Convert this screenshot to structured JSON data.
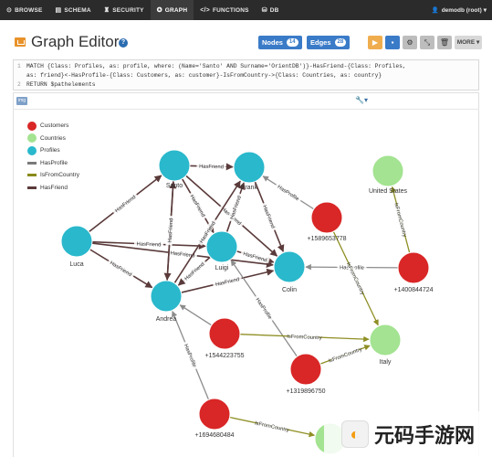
{
  "nav": {
    "items": [
      {
        "icon": "⊙",
        "label": "BROWSE",
        "active": false,
        "name": "browse"
      },
      {
        "icon": "▤",
        "label": "SCHEMA",
        "active": false,
        "name": "schema"
      },
      {
        "icon": "♜",
        "label": "SECURITY",
        "active": false,
        "name": "security"
      },
      {
        "icon": "✪",
        "label": "GRAPH",
        "active": true,
        "name": "graph"
      },
      {
        "icon": "</>",
        "label": "FUNCTIONS",
        "active": false,
        "name": "functions"
      },
      {
        "icon": "⛁",
        "label": "DB",
        "active": false,
        "name": "db"
      }
    ],
    "user": "demodb (root)"
  },
  "header": {
    "title": "Graph Editor",
    "help": "?",
    "nodes_label": "Nodes",
    "nodes_count": "14",
    "edges_label": "Edges",
    "edges_count": "28",
    "more_label": "MORE"
  },
  "query": {
    "lines": [
      [
        "1",
        "MATCH {Class: Profiles, as: profile, where: (Name='Santo' AND Surname='OrientDB')}-HasFriend-{Class: Profiles,"
      ],
      [
        "",
        "as: friend}<-HasProfile-{Class: Customers, as: customer}-IsFromCountry->{Class: Countries, as: country}"
      ],
      [
        "2",
        "RETURN $pathelements"
      ]
    ]
  },
  "legend": [
    {
      "type": "dot",
      "label": "Customers",
      "color": "#d92626"
    },
    {
      "type": "dot",
      "label": "Countries",
      "color": "#a3e391"
    },
    {
      "type": "dot",
      "label": "Profiles",
      "color": "#2ab8cc"
    },
    {
      "type": "line",
      "label": "HasProfile",
      "color": "#7a7a7a"
    },
    {
      "type": "line",
      "label": "IsFromCountry",
      "color": "#8a8a1a"
    },
    {
      "type": "line",
      "label": "HasFriend",
      "color": "#5a3a3a"
    }
  ],
  "colors": {
    "customer": "#d92626",
    "country": "#a3e391",
    "profile": "#2ab8cc",
    "hasFriend": "#5a3a3a",
    "hasProfile": "#8c8c8c",
    "isFromCountry": "#8f8f25"
  },
  "nodes": [
    {
      "id": "santo",
      "label": "Santo",
      "kind": "profile"
    },
    {
      "id": "frank",
      "label": "Frank",
      "kind": "profile"
    },
    {
      "id": "luca",
      "label": "Luca",
      "kind": "profile"
    },
    {
      "id": "luigi",
      "label": "Luigi",
      "kind": "profile"
    },
    {
      "id": "colin",
      "label": "Colin",
      "kind": "profile"
    },
    {
      "id": "andrea",
      "label": "Andrea",
      "kind": "profile"
    },
    {
      "id": "c1589",
      "label": "+1589653778",
      "kind": "customer"
    },
    {
      "id": "c1400",
      "label": "+1400844724",
      "kind": "customer"
    },
    {
      "id": "c1544",
      "label": "+1544223755",
      "kind": "customer"
    },
    {
      "id": "c1319",
      "label": "+1319896750",
      "kind": "customer"
    },
    {
      "id": "c1694",
      "label": "+1694680484",
      "kind": "customer"
    },
    {
      "id": "us",
      "label": "United States",
      "kind": "country"
    },
    {
      "id": "italy",
      "label": "Italy",
      "kind": "country"
    },
    {
      "id": "country3",
      "label": "",
      "kind": "country"
    }
  ],
  "edges": [
    {
      "from": "santo",
      "to": "frank",
      "label": "HasFriend",
      "kind": "hasFriend"
    },
    {
      "from": "luca",
      "to": "santo",
      "label": "HasFriend",
      "kind": "hasFriend"
    },
    {
      "from": "luca",
      "to": "luigi",
      "label": "HasFriend",
      "kind": "hasFriend"
    },
    {
      "from": "luca",
      "to": "colin",
      "label": "HasFriend",
      "kind": "hasFriend"
    },
    {
      "from": "luca",
      "to": "andrea",
      "label": "HasFriend",
      "kind": "hasFriend"
    },
    {
      "from": "andrea",
      "to": "santo",
      "label": "HasFriend",
      "kind": "hasFriend"
    },
    {
      "from": "santo",
      "to": "luigi",
      "label": "HasFriend",
      "kind": "hasFriend"
    },
    {
      "from": "santo",
      "to": "colin",
      "label": "HasFriend",
      "kind": "hasFriend"
    },
    {
      "from": "luigi",
      "to": "frank",
      "label": "HasFriend",
      "kind": "hasFriend"
    },
    {
      "from": "andrea",
      "to": "frank",
      "label": "HasFriend",
      "kind": "hasFriend"
    },
    {
      "from": "andrea",
      "to": "colin",
      "label": "HasFriend",
      "kind": "hasFriend"
    },
    {
      "from": "luigi",
      "to": "colin",
      "label": "HasFriend",
      "kind": "hasFriend"
    },
    {
      "from": "santo",
      "to": "andrea",
      "label": "HasFriend",
      "kind": "hasFriend"
    },
    {
      "from": "luigi",
      "to": "andrea",
      "label": "HasFriend",
      "kind": "hasFriend"
    },
    {
      "from": "frank",
      "to": "colin",
      "label": "HasFriend",
      "kind": "hasFriend"
    },
    {
      "from": "c1589",
      "to": "frank",
      "label": "HasProfile",
      "kind": "hasProfile"
    },
    {
      "from": "c1400",
      "to": "colin",
      "label": "HasProfile",
      "kind": "hasProfile"
    },
    {
      "from": "c1319",
      "to": "luigi",
      "label": "HasProfile",
      "kind": "hasProfile"
    },
    {
      "from": "c1694",
      "to": "andrea",
      "label": "HasProfile",
      "kind": "hasProfile"
    },
    {
      "from": "c1544",
      "to": "andrea",
      "label": "",
      "kind": "hasProfile"
    },
    {
      "from": "c1589",
      "to": "italy",
      "label": "IsFromCountry",
      "kind": "isFromCountry"
    },
    {
      "from": "c1400",
      "to": "us",
      "label": "IsFromCountry",
      "kind": "isFromCountry"
    },
    {
      "from": "c1544",
      "to": "italy",
      "label": "IsFromCountry",
      "kind": "isFromCountry"
    },
    {
      "from": "c1319",
      "to": "italy",
      "label": "IsFromCountry",
      "kind": "isFromCountry"
    },
    {
      "from": "c1694",
      "to": "country3",
      "label": "IsFromCountry",
      "kind": "isFromCountry"
    }
  ],
  "watermark": {
    "text": "元码手游网"
  }
}
